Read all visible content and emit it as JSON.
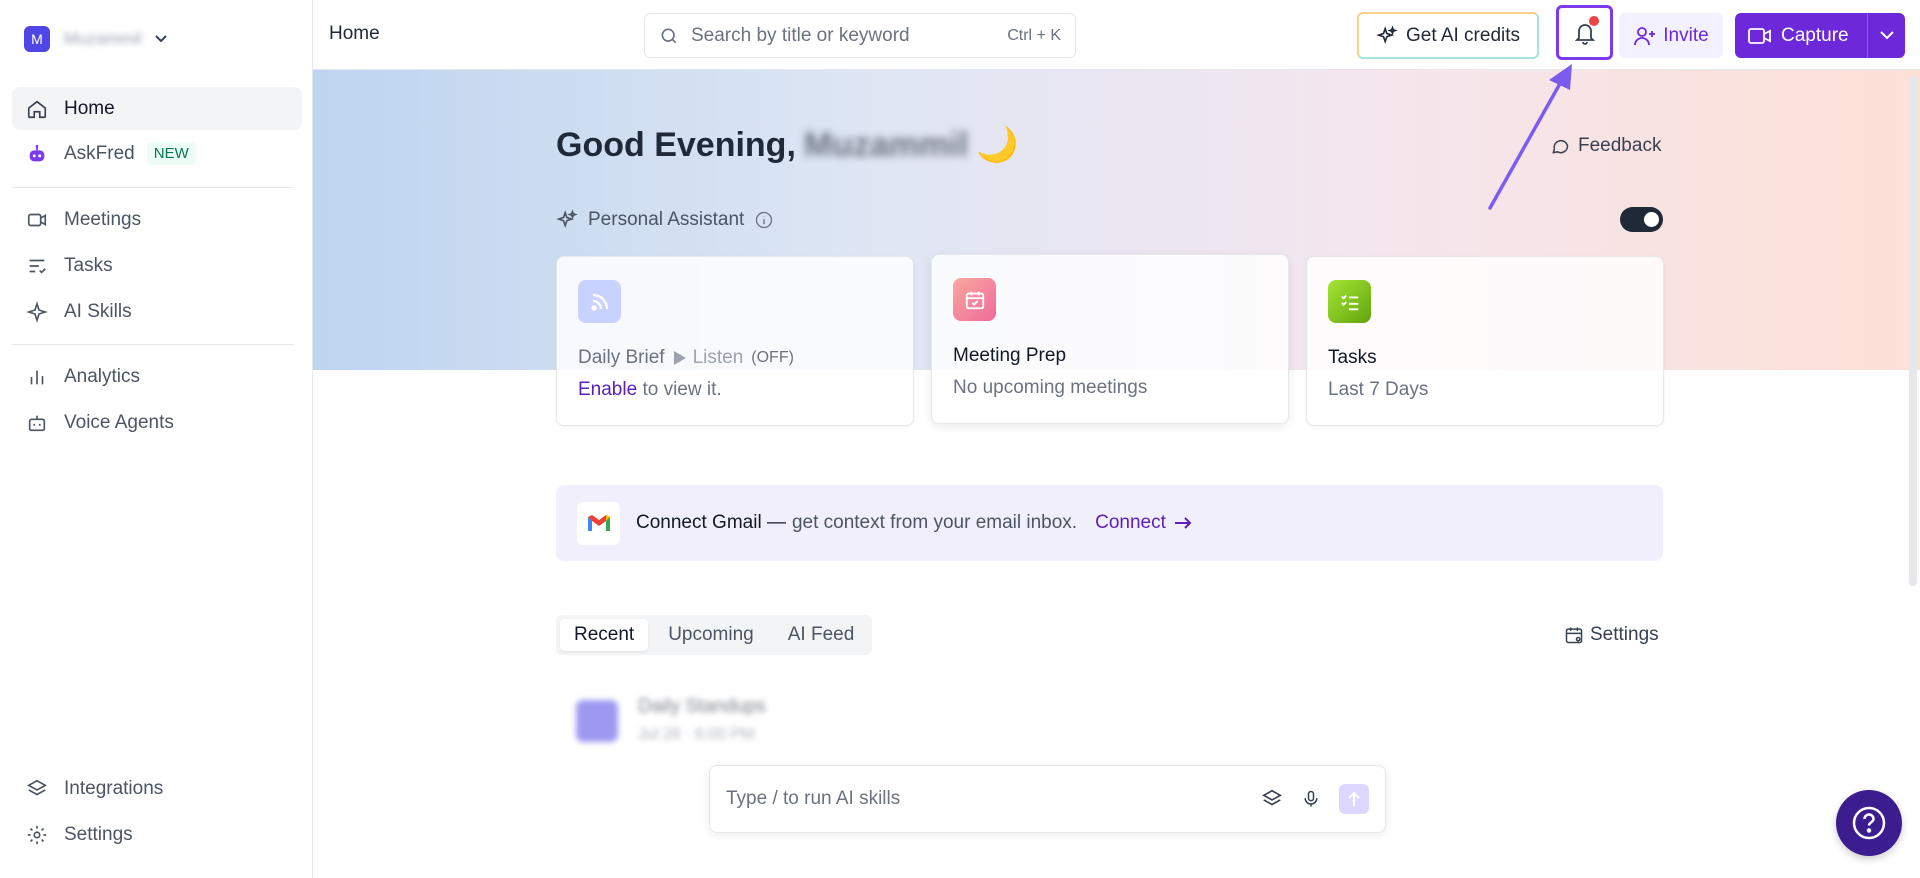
{
  "workspace": {
    "initial": "M",
    "name": "Muzammil"
  },
  "sidebar": {
    "items": [
      {
        "label": "Home",
        "icon": "home-icon"
      },
      {
        "label": "AskFred",
        "icon": "robot-icon",
        "badge": "NEW"
      },
      {
        "label": "Meetings",
        "icon": "video-icon"
      },
      {
        "label": "Tasks",
        "icon": "tasks-icon"
      },
      {
        "label": "AI Skills",
        "icon": "sparkle-icon"
      },
      {
        "label": "Analytics",
        "icon": "bar-chart-icon"
      },
      {
        "label": "Voice Agents",
        "icon": "bot-icon"
      }
    ],
    "bottom": [
      {
        "label": "Integrations",
        "icon": "layers-icon"
      },
      {
        "label": "Settings",
        "icon": "gear-icon"
      }
    ]
  },
  "topbar": {
    "breadcrumb": "Home",
    "search_placeholder": "Search by title or keyword",
    "search_shortcut": "Ctrl + K",
    "credits_label": "Get AI credits",
    "invite_label": "Invite",
    "capture_label": "Capture"
  },
  "main": {
    "greeting": "Good Evening,",
    "greeting_name": "Muzammil",
    "greeting_emoji": "🌙",
    "feedback_label": "Feedback",
    "assistant_label": "Personal Assistant",
    "assistant_enabled": true,
    "cards": [
      {
        "title": "Daily Brief",
        "listen": "Listen",
        "listen_state": "(OFF)",
        "enable_link": "Enable",
        "sub": "to view it."
      },
      {
        "title": "Meeting Prep",
        "sub": "No upcoming meetings"
      },
      {
        "title": "Tasks",
        "sub": "Last 7 Days"
      }
    ],
    "gmail": {
      "title": "Connect Gmail —",
      "text": "get context from your email inbox.",
      "cta": "Connect"
    },
    "tabs": [
      "Recent",
      "Upcoming",
      "AI Feed"
    ],
    "active_tab": "Recent",
    "settings_label": "Settings",
    "meeting_row": {
      "title": "Daily Standups",
      "time": "Jul 28 · 6:00 PM"
    },
    "ai_input_placeholder": "Type / to run AI skills"
  },
  "colors": {
    "accent": "#6d28d9",
    "highlight": "#7c3aed",
    "notification_dot": "#ef4444",
    "help_button": "#3b1d8f"
  }
}
